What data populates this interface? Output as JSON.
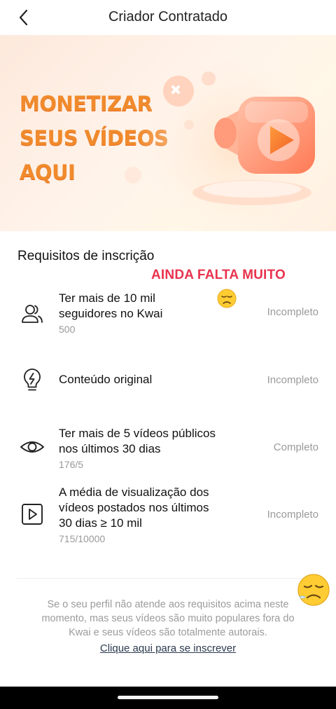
{
  "header": {
    "title": "Criador Contratado",
    "back_icon": "chevron-left-icon"
  },
  "banner": {
    "lines": [
      "MONETIZAR",
      "SEUS VÍDEOS",
      "AQUI"
    ]
  },
  "section": {
    "title": "Requisitos de inscrição"
  },
  "annotation": {
    "text": "AINDA FALTA MUITO"
  },
  "requirements": [
    {
      "icon": "users-icon",
      "lines": [
        "Ter mais de 10 mil",
        "seguidores no Kwai"
      ],
      "progress": "500",
      "status": "Incompleto"
    },
    {
      "icon": "lightbulb-icon",
      "lines": [
        "Conteúdo original"
      ],
      "progress": "",
      "status": "Incompleto"
    },
    {
      "icon": "eye-icon",
      "lines": [
        "Ter mais de 5 vídeos públicos",
        "nos últimos 30 dias"
      ],
      "progress": "176/5",
      "status": "Completo"
    },
    {
      "icon": "play-square-icon",
      "lines": [
        "A média de visualização dos",
        "vídeos postados nos últimos",
        "30 dias ≥ 10 mil"
      ],
      "progress": "715/10000",
      "status": "Incompleto"
    }
  ],
  "footer": {
    "lines": [
      "Se o seu perfil não atende aos requisitos acima neste",
      "momento, mas seus vídeos são muito populares fora do",
      "Kwai e seus vídeos são totalmente autorais."
    ],
    "link": "Clique aqui para se inscrever"
  },
  "colors": {
    "accent_orange": "#f08a2c",
    "annotation_red": "#e8344e",
    "muted_text": "#9a9a9a"
  }
}
